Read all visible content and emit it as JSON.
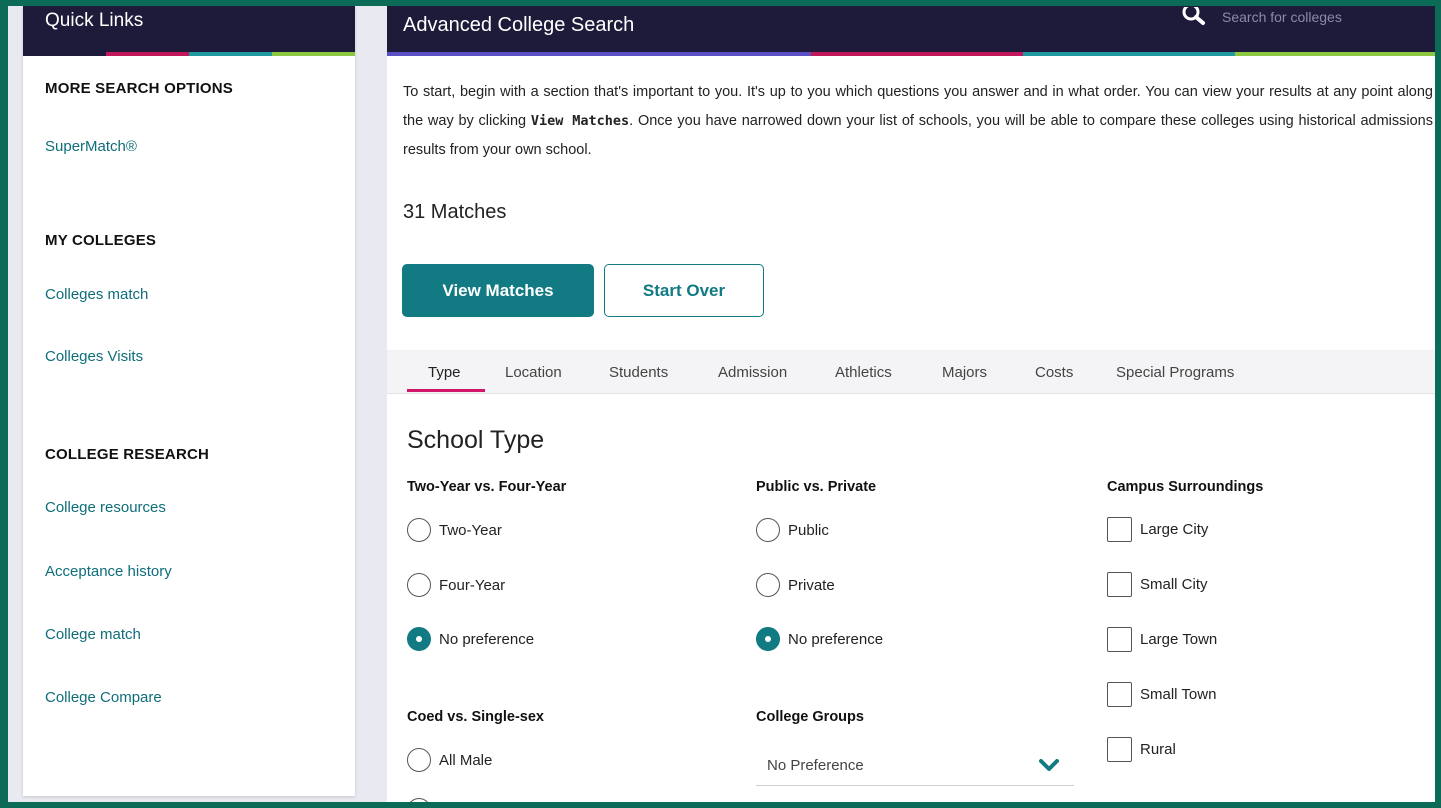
{
  "sidebar": {
    "title": "Quick Links",
    "sections": [
      {
        "heading": "MORE SEARCH OPTIONS",
        "links": [
          "SuperMatch®"
        ]
      },
      {
        "heading": "MY COLLEGES",
        "links": [
          "Colleges match",
          "Colleges Visits"
        ]
      },
      {
        "heading": "COLLEGE RESEARCH",
        "links": [
          "College resources",
          "Acceptance history",
          "College match",
          "College Compare"
        ]
      }
    ]
  },
  "header": {
    "title": "Advanced College Search",
    "search_placeholder": "Search for colleges",
    "stripe_colors": [
      "#5a4fc4",
      "#5a4fc4",
      "#c2185b",
      "#1e9aa0",
      "#8dc63f"
    ]
  },
  "intro": {
    "part1": "To start, begin with a section that's important to you. It's up to you which questions you answer and in what order. You can view your results at any point along the way by clicking ",
    "bold": "View Matches",
    "part2": ". Once you have narrowed down your list of schools, you will be able to compare these colleges using historical admissions results from your own school."
  },
  "matches_text": "31 Matches",
  "buttons": {
    "view_matches": "View Matches",
    "start_over": "Start Over"
  },
  "tabs": [
    "Type",
    "Location",
    "Students",
    "Admission",
    "Athletics",
    "Majors",
    "Costs",
    "Special Programs"
  ],
  "active_tab": "Type",
  "section_title": "School Type",
  "groups": {
    "two_four": {
      "title": "Two-Year vs. Four-Year",
      "options": [
        "Two-Year",
        "Four-Year",
        "No preference"
      ],
      "selected": "No preference"
    },
    "public_private": {
      "title": "Public vs. Private",
      "options": [
        "Public",
        "Private",
        "No preference"
      ],
      "selected": "No preference"
    },
    "campus": {
      "title": "Campus Surroundings",
      "options": [
        "Large City",
        "Small City",
        "Large Town",
        "Small Town",
        "Rural"
      ]
    },
    "coed": {
      "title": "Coed vs. Single-sex",
      "options": [
        "All Male"
      ]
    },
    "college_groups": {
      "title": "College Groups",
      "value": "No Preference"
    }
  },
  "colors": {
    "accent": "#117a82",
    "header_bg": "#1e1b3a",
    "tab_underline": "#d0176a",
    "link": "#0e6e7a"
  }
}
